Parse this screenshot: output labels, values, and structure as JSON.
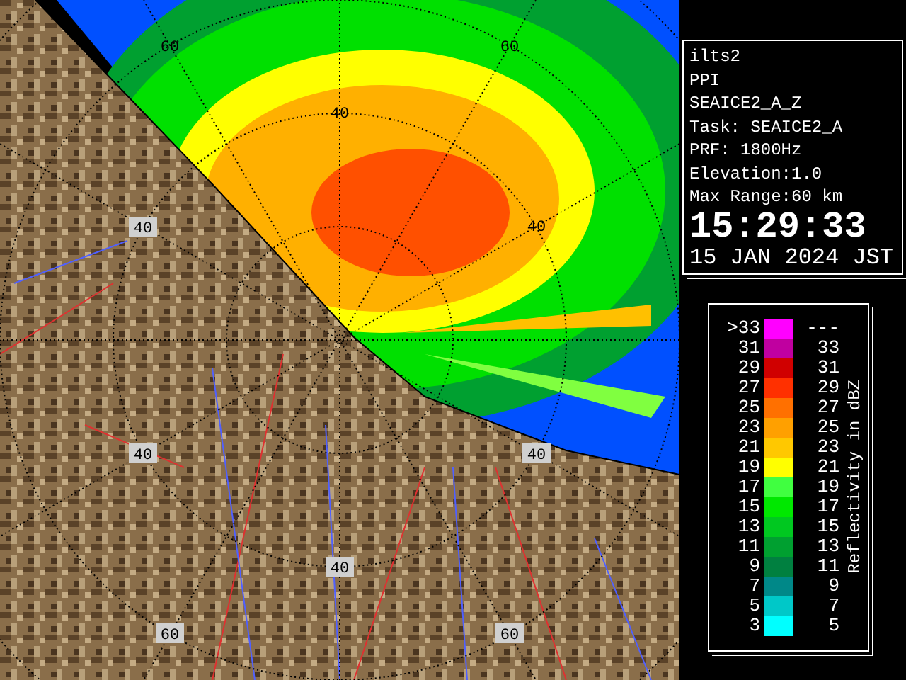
{
  "radar_map": {
    "range_labels": [
      {
        "text": "60",
        "boxed": false
      },
      {
        "text": "60",
        "boxed": false
      },
      {
        "text": "40",
        "boxed": false
      },
      {
        "text": "40",
        "boxed": false
      },
      {
        "text": "40",
        "boxed": true
      },
      {
        "text": "40",
        "boxed": true
      },
      {
        "text": "40",
        "boxed": true
      },
      {
        "text": "40",
        "boxed": true
      },
      {
        "text": "60",
        "boxed": true
      },
      {
        "text": "60",
        "boxed": true
      }
    ]
  },
  "info_panel": {
    "lines": [
      "ilts2",
      "PPI",
      "SEAICE2_A_Z",
      "Task: SEAICE2_A",
      "PRF: 1800Hz",
      "Elevation:1.0",
      "Max Range:60 km"
    ],
    "time": "15:29:33",
    "date": "15 JAN 2024 JST"
  },
  "legend": {
    "title": "Reflectivity in dBZ",
    "items": [
      {
        "low": ">33",
        "high": "---",
        "color": "#ff00ff"
      },
      {
        "low": "31",
        "high": "33",
        "color": "#c000a0"
      },
      {
        "low": "29",
        "high": "31",
        "color": "#d00000"
      },
      {
        "low": "27",
        "high": "29",
        "color": "#ff3000"
      },
      {
        "low": "25",
        "high": "27",
        "color": "#ff7000"
      },
      {
        "low": "23",
        "high": "25",
        "color": "#ffa000"
      },
      {
        "low": "21",
        "high": "23",
        "color": "#ffc800"
      },
      {
        "low": "19",
        "high": "21",
        "color": "#ffff00"
      },
      {
        "low": "17",
        "high": "19",
        "color": "#40ff40"
      },
      {
        "low": "15",
        "high": "17",
        "color": "#00e800"
      },
      {
        "low": "13",
        "high": "15",
        "color": "#00c820"
      },
      {
        "low": "11",
        "high": "13",
        "color": "#00a030"
      },
      {
        "low": "9",
        "high": "11",
        "color": "#008040"
      },
      {
        "low": "7",
        "high": "9",
        "color": "#008888"
      },
      {
        "low": "5",
        "high": "7",
        "color": "#00c8c8"
      },
      {
        "low": "3",
        "high": "5",
        "color": "#00ffff"
      }
    ]
  }
}
